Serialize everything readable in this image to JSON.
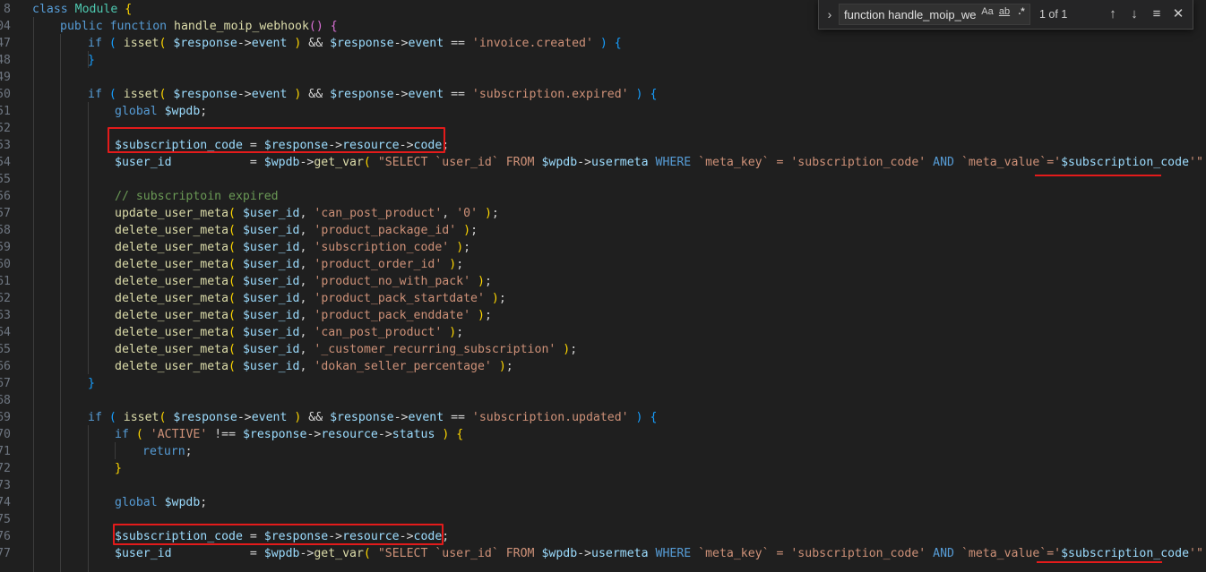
{
  "find_widget": {
    "query": "function handle_moip_we",
    "match_case_label": "Aa",
    "whole_word_label": "ab",
    "regex_label": ".*",
    "result_count": "1 of 1"
  },
  "gutter": [
    "8",
    "04",
    "47",
    "48",
    "49",
    "50",
    "51",
    "52",
    "53",
    "54",
    "55",
    "56",
    "57",
    "58",
    "59",
    "60",
    "61",
    "62",
    "63",
    "64",
    "65",
    "66",
    "67",
    "68",
    "69",
    "70",
    "71",
    "72",
    "73",
    "74",
    "75",
    "76",
    "77"
  ],
  "icons": [
    "expand-chevron-icon",
    "arrow-up-icon",
    "arrow-down-icon",
    "selection-list-icon",
    "close-icon"
  ],
  "colors": {
    "background": "#1f1f1f",
    "keyword": "#569cd6",
    "string": "#ce9178",
    "variable": "#9cdcfe",
    "function": "#dcdcaa",
    "comment": "#6a9955",
    "annotation": "#e31b1b"
  },
  "lines": [
    [
      [
        "kw",
        "class "
      ],
      [
        "cl",
        "Module"
      ],
      [
        "pu",
        " "
      ],
      [
        "br1",
        "{"
      ]
    ],
    [
      [
        "kw",
        "public function "
      ],
      [
        "fn",
        "handle_moip_webhook"
      ],
      [
        "br2",
        "()"
      ],
      [
        "pu",
        " "
      ],
      [
        "br2",
        "{"
      ]
    ],
    [
      [
        "kw",
        "if"
      ],
      [
        "pu",
        " "
      ],
      [
        "br3",
        "("
      ],
      [
        "pu",
        " "
      ],
      [
        "fn",
        "isset"
      ],
      [
        "br1",
        "("
      ],
      [
        "pu",
        " "
      ],
      [
        "vr",
        "$response"
      ],
      [
        "op",
        "->"
      ],
      [
        "vr",
        "event"
      ],
      [
        "pu",
        " "
      ],
      [
        "br1",
        ")"
      ],
      [
        "op",
        " && "
      ],
      [
        "vr",
        "$response"
      ],
      [
        "op",
        "->"
      ],
      [
        "vr",
        "event"
      ],
      [
        "op",
        " == "
      ],
      [
        "st",
        "'invoice.created'"
      ],
      [
        "pu",
        " "
      ],
      [
        "br3",
        ")"
      ],
      [
        "pu",
        " "
      ],
      [
        "br3",
        "{"
      ]
    ],
    [
      [
        "br3",
        "}"
      ]
    ],
    [],
    [
      [
        "kw",
        "if"
      ],
      [
        "pu",
        " "
      ],
      [
        "br3",
        "("
      ],
      [
        "pu",
        " "
      ],
      [
        "fn",
        "isset"
      ],
      [
        "br1",
        "("
      ],
      [
        "pu",
        " "
      ],
      [
        "vr",
        "$response"
      ],
      [
        "op",
        "->"
      ],
      [
        "vr",
        "event"
      ],
      [
        "pu",
        " "
      ],
      [
        "br1",
        ")"
      ],
      [
        "op",
        " && "
      ],
      [
        "vr",
        "$response"
      ],
      [
        "op",
        "->"
      ],
      [
        "vr",
        "event"
      ],
      [
        "op",
        " == "
      ],
      [
        "st",
        "'subscription.expired'"
      ],
      [
        "pu",
        " "
      ],
      [
        "br3",
        ")"
      ],
      [
        "pu",
        " "
      ],
      [
        "br3",
        "{"
      ]
    ],
    [
      [
        "kw",
        "global "
      ],
      [
        "vr",
        "$wpdb"
      ],
      [
        "pu",
        ";"
      ]
    ],
    [],
    [
      [
        "vr",
        "$subscription_code"
      ],
      [
        "op",
        " = "
      ],
      [
        "vr",
        "$response"
      ],
      [
        "op",
        "->"
      ],
      [
        "vr",
        "resource"
      ],
      [
        "op",
        "->"
      ],
      [
        "vr",
        "code"
      ],
      [
        "pu",
        ";"
      ]
    ],
    [
      [
        "vr",
        "$user_id"
      ],
      [
        "op",
        "           = "
      ],
      [
        "vr",
        "$wpdb"
      ],
      [
        "op",
        "->"
      ],
      [
        "fn",
        "get_var"
      ],
      [
        "br1",
        "("
      ],
      [
        "pu",
        " "
      ],
      [
        "st",
        "\"SELECT `user_id` FROM "
      ],
      [
        "vr",
        "$wpdb"
      ],
      [
        "op",
        "->"
      ],
      [
        "vr",
        "usermeta"
      ],
      [
        "kw",
        " WHERE "
      ],
      [
        "st",
        "`meta_key` = 'subscription_code' "
      ],
      [
        "kw",
        "AND"
      ],
      [
        "st",
        " `meta_value`='"
      ],
      [
        "vr",
        "$subscription_code"
      ],
      [
        "st",
        "'\""
      ],
      [
        "pu",
        " "
      ],
      [
        "br1",
        ")"
      ],
      [
        "pu",
        ";"
      ]
    ],
    [],
    [
      [
        "cm",
        "// subscriptoin expired"
      ]
    ],
    [
      [
        "fn",
        "update_user_meta"
      ],
      [
        "br1",
        "("
      ],
      [
        "pu",
        " "
      ],
      [
        "vr",
        "$user_id"
      ],
      [
        "pu",
        ", "
      ],
      [
        "st",
        "'can_post_product'"
      ],
      [
        "pu",
        ", "
      ],
      [
        "st",
        "'0'"
      ],
      [
        "pu",
        " "
      ],
      [
        "br1",
        ")"
      ],
      [
        "pu",
        ";"
      ]
    ],
    [
      [
        "fn",
        "delete_user_meta"
      ],
      [
        "br1",
        "("
      ],
      [
        "pu",
        " "
      ],
      [
        "vr",
        "$user_id"
      ],
      [
        "pu",
        ", "
      ],
      [
        "st",
        "'product_package_id'"
      ],
      [
        "pu",
        " "
      ],
      [
        "br1",
        ")"
      ],
      [
        "pu",
        ";"
      ]
    ],
    [
      [
        "fn",
        "delete_user_meta"
      ],
      [
        "br1",
        "("
      ],
      [
        "pu",
        " "
      ],
      [
        "vr",
        "$user_id"
      ],
      [
        "pu",
        ", "
      ],
      [
        "st",
        "'subscription_code'"
      ],
      [
        "pu",
        " "
      ],
      [
        "br1",
        ")"
      ],
      [
        "pu",
        ";"
      ]
    ],
    [
      [
        "fn",
        "delete_user_meta"
      ],
      [
        "br1",
        "("
      ],
      [
        "pu",
        " "
      ],
      [
        "vr",
        "$user_id"
      ],
      [
        "pu",
        ", "
      ],
      [
        "st",
        "'product_order_id'"
      ],
      [
        "pu",
        " "
      ],
      [
        "br1",
        ")"
      ],
      [
        "pu",
        ";"
      ]
    ],
    [
      [
        "fn",
        "delete_user_meta"
      ],
      [
        "br1",
        "("
      ],
      [
        "pu",
        " "
      ],
      [
        "vr",
        "$user_id"
      ],
      [
        "pu",
        ", "
      ],
      [
        "st",
        "'product_no_with_pack'"
      ],
      [
        "pu",
        " "
      ],
      [
        "br1",
        ")"
      ],
      [
        "pu",
        ";"
      ]
    ],
    [
      [
        "fn",
        "delete_user_meta"
      ],
      [
        "br1",
        "("
      ],
      [
        "pu",
        " "
      ],
      [
        "vr",
        "$user_id"
      ],
      [
        "pu",
        ", "
      ],
      [
        "st",
        "'product_pack_startdate'"
      ],
      [
        "pu",
        " "
      ],
      [
        "br1",
        ")"
      ],
      [
        "pu",
        ";"
      ]
    ],
    [
      [
        "fn",
        "delete_user_meta"
      ],
      [
        "br1",
        "("
      ],
      [
        "pu",
        " "
      ],
      [
        "vr",
        "$user_id"
      ],
      [
        "pu",
        ", "
      ],
      [
        "st",
        "'product_pack_enddate'"
      ],
      [
        "pu",
        " "
      ],
      [
        "br1",
        ")"
      ],
      [
        "pu",
        ";"
      ]
    ],
    [
      [
        "fn",
        "delete_user_meta"
      ],
      [
        "br1",
        "("
      ],
      [
        "pu",
        " "
      ],
      [
        "vr",
        "$user_id"
      ],
      [
        "pu",
        ", "
      ],
      [
        "st",
        "'can_post_product'"
      ],
      [
        "pu",
        " "
      ],
      [
        "br1",
        ")"
      ],
      [
        "pu",
        ";"
      ]
    ],
    [
      [
        "fn",
        "delete_user_meta"
      ],
      [
        "br1",
        "("
      ],
      [
        "pu",
        " "
      ],
      [
        "vr",
        "$user_id"
      ],
      [
        "pu",
        ", "
      ],
      [
        "st",
        "'_customer_recurring_subscription'"
      ],
      [
        "pu",
        " "
      ],
      [
        "br1",
        ")"
      ],
      [
        "pu",
        ";"
      ]
    ],
    [
      [
        "fn",
        "delete_user_meta"
      ],
      [
        "br1",
        "("
      ],
      [
        "pu",
        " "
      ],
      [
        "vr",
        "$user_id"
      ],
      [
        "pu",
        ", "
      ],
      [
        "st",
        "'dokan_seller_percentage'"
      ],
      [
        "pu",
        " "
      ],
      [
        "br1",
        ")"
      ],
      [
        "pu",
        ";"
      ]
    ],
    [
      [
        "br3",
        "}"
      ]
    ],
    [],
    [
      [
        "kw",
        "if"
      ],
      [
        "pu",
        " "
      ],
      [
        "br3",
        "("
      ],
      [
        "pu",
        " "
      ],
      [
        "fn",
        "isset"
      ],
      [
        "br1",
        "("
      ],
      [
        "pu",
        " "
      ],
      [
        "vr",
        "$response"
      ],
      [
        "op",
        "->"
      ],
      [
        "vr",
        "event"
      ],
      [
        "pu",
        " "
      ],
      [
        "br1",
        ")"
      ],
      [
        "op",
        " && "
      ],
      [
        "vr",
        "$response"
      ],
      [
        "op",
        "->"
      ],
      [
        "vr",
        "event"
      ],
      [
        "op",
        " == "
      ],
      [
        "st",
        "'subscription.updated'"
      ],
      [
        "pu",
        " "
      ],
      [
        "br3",
        ")"
      ],
      [
        "pu",
        " "
      ],
      [
        "br3",
        "{"
      ]
    ],
    [
      [
        "kw",
        "if"
      ],
      [
        "pu",
        " "
      ],
      [
        "br1",
        "("
      ],
      [
        "pu",
        " "
      ],
      [
        "st",
        "'ACTIVE'"
      ],
      [
        "op",
        " !== "
      ],
      [
        "vr",
        "$response"
      ],
      [
        "op",
        "->"
      ],
      [
        "vr",
        "resource"
      ],
      [
        "op",
        "->"
      ],
      [
        "vr",
        "status"
      ],
      [
        "pu",
        " "
      ],
      [
        "br1",
        ")"
      ],
      [
        "pu",
        " "
      ],
      [
        "br1",
        "{"
      ]
    ],
    [
      [
        "kw",
        "return"
      ],
      [
        "pu",
        ";"
      ]
    ],
    [
      [
        "br1",
        "}"
      ]
    ],
    [],
    [
      [
        "kw",
        "global "
      ],
      [
        "vr",
        "$wpdb"
      ],
      [
        "pu",
        ";"
      ]
    ],
    [],
    [
      [
        "vr",
        "$subscription_code"
      ],
      [
        "op",
        " = "
      ],
      [
        "vr",
        "$response"
      ],
      [
        "op",
        "->"
      ],
      [
        "vr",
        "resource"
      ],
      [
        "op",
        "->"
      ],
      [
        "vr",
        "code"
      ],
      [
        "pu",
        ";"
      ]
    ],
    [
      [
        "vr",
        "$user_id"
      ],
      [
        "op",
        "           = "
      ],
      [
        "vr",
        "$wpdb"
      ],
      [
        "op",
        "->"
      ],
      [
        "fn",
        "get_var"
      ],
      [
        "br1",
        "("
      ],
      [
        "pu",
        " "
      ],
      [
        "st",
        "\"SELECT `user_id` FROM "
      ],
      [
        "vr",
        "$wpdb"
      ],
      [
        "op",
        "->"
      ],
      [
        "vr",
        "usermeta"
      ],
      [
        "kw",
        " WHERE "
      ],
      [
        "st",
        "`meta_key` = 'subscription_code' "
      ],
      [
        "kw",
        "AND"
      ],
      [
        "st",
        " `meta_value`='"
      ],
      [
        "vr",
        "$subscription_code"
      ],
      [
        "st",
        "'\""
      ],
      [
        "pu",
        " "
      ],
      [
        "br1",
        ")"
      ],
      [
        "pu",
        ";"
      ]
    ]
  ]
}
